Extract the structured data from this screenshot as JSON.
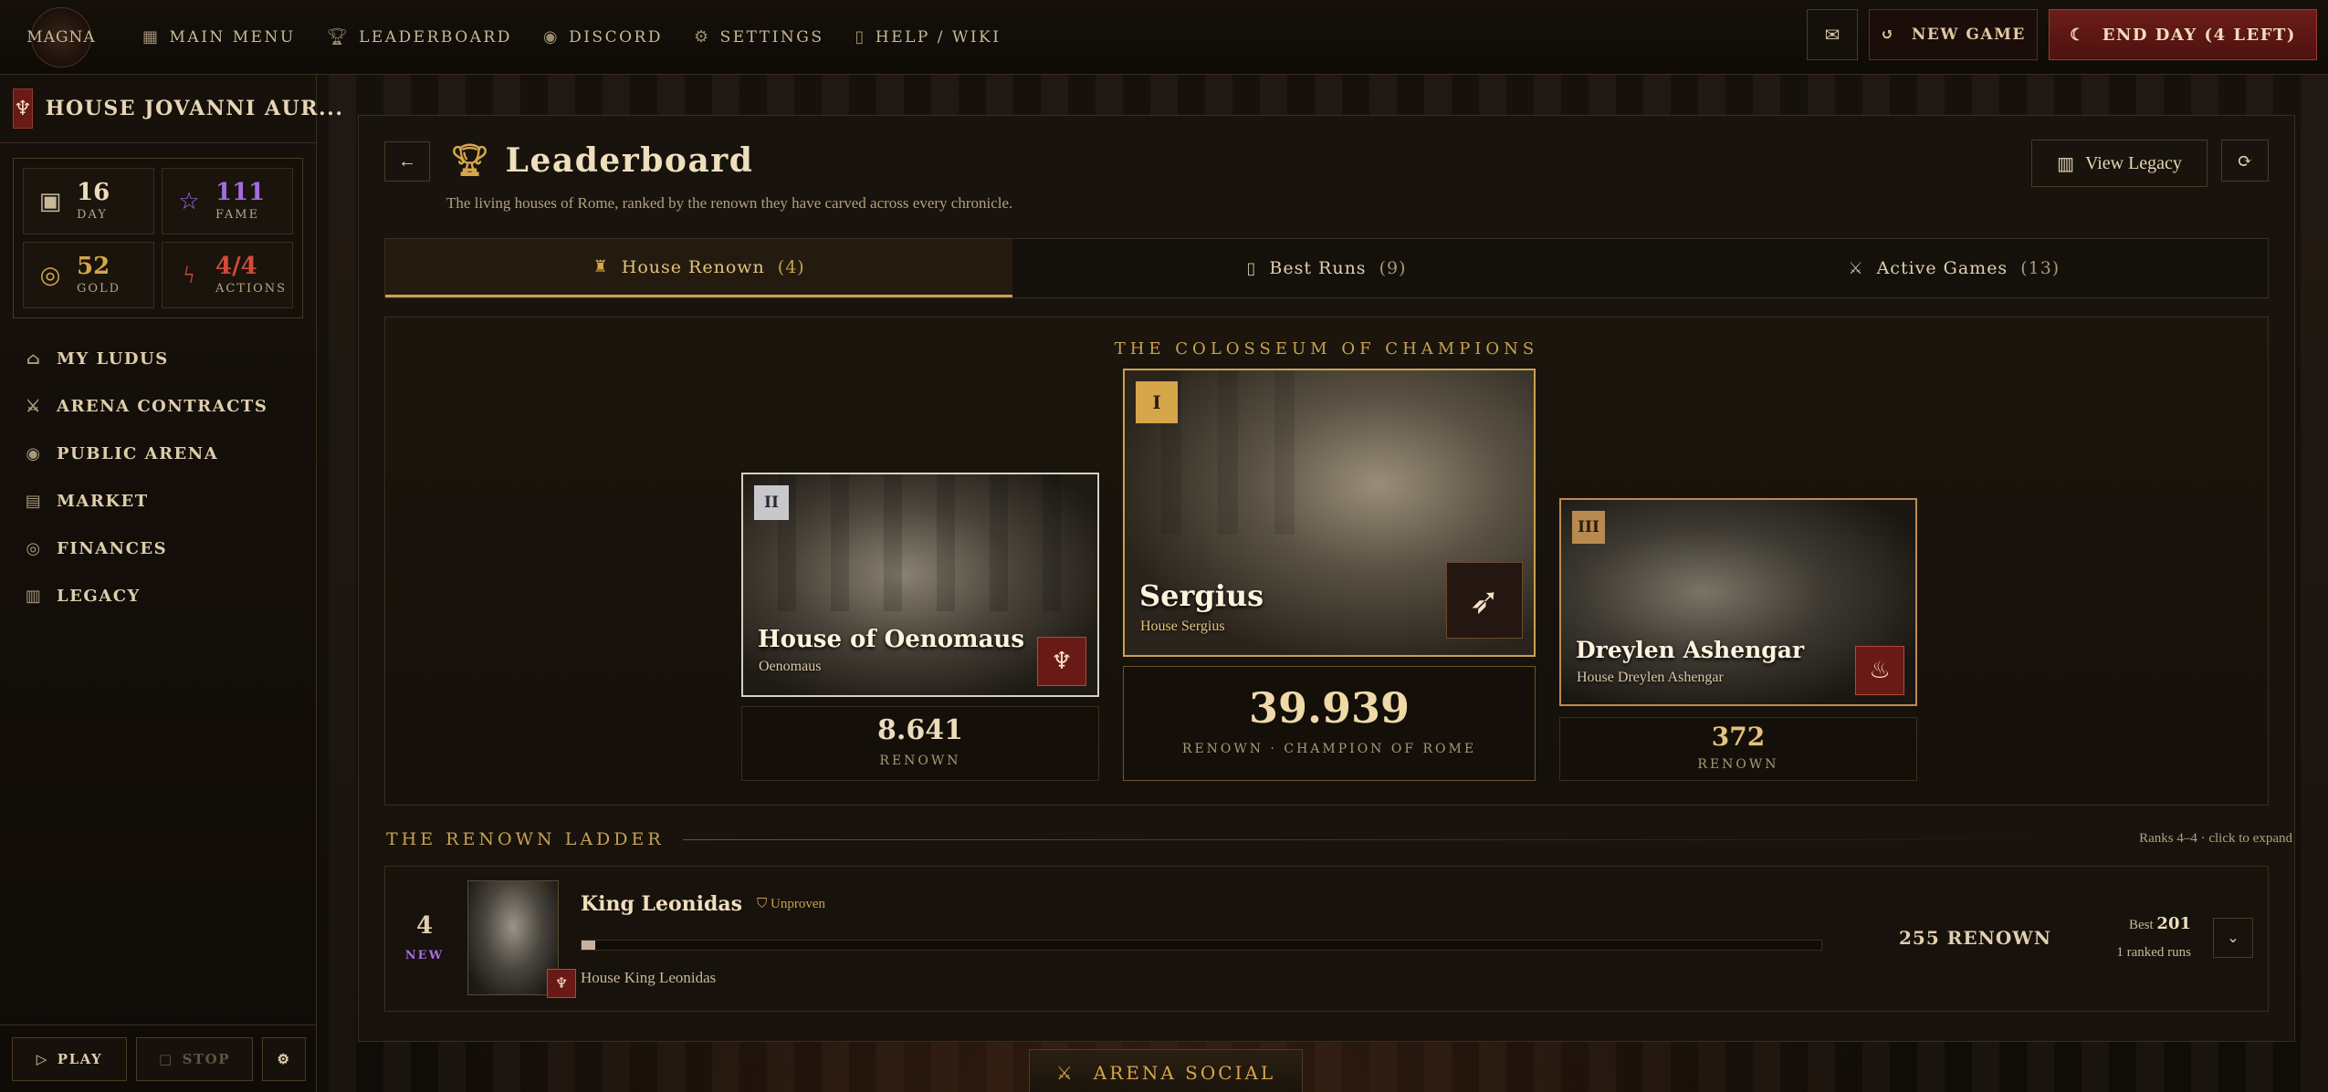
{
  "logo": "MAGNA",
  "nav": [
    {
      "label": "Main Menu",
      "icon": "grid-icon"
    },
    {
      "label": "Leaderboard",
      "icon": "trophy-icon"
    },
    {
      "label": "Discord",
      "icon": "discord-icon"
    },
    {
      "label": "Settings",
      "icon": "gear-icon"
    },
    {
      "label": "Help / Wiki",
      "icon": "book-icon"
    }
  ],
  "topbar": {
    "new_game": "NEW GAME",
    "end_day": "END DAY (4 LEFT)"
  },
  "sidebar": {
    "house_name": "HOUSE JOVANNI AUR...",
    "stats": {
      "day": {
        "value": "16",
        "label": "Day"
      },
      "fame": {
        "value": "111",
        "label": "Fame"
      },
      "gold": {
        "value": "52",
        "label": "Gold"
      },
      "actions": {
        "value": "4/4",
        "label": "Actions"
      }
    },
    "items": [
      {
        "label": "My Ludus",
        "icon": "home-icon"
      },
      {
        "label": "Arena Contracts",
        "icon": "swords-icon"
      },
      {
        "label": "Public Arena",
        "icon": "eye-icon"
      },
      {
        "label": "Market",
        "icon": "market-icon"
      },
      {
        "label": "Finances",
        "icon": "coins-icon"
      },
      {
        "label": "Legacy",
        "icon": "scroll-icon"
      }
    ],
    "play": "PLAY",
    "stop": "STOP"
  },
  "page": {
    "title": "Leaderboard",
    "subtitle": "The living houses of Rome, ranked by the renown they have carved across every chronicle.",
    "view_legacy": "View Legacy"
  },
  "tabs": [
    {
      "label": "House Renown",
      "count": "(4)",
      "active": true
    },
    {
      "label": "Best Runs",
      "count": "(9)",
      "active": false
    },
    {
      "label": "Active Games",
      "count": "(13)",
      "active": false
    }
  ],
  "podium": {
    "title": "The Colosseum of Champions",
    "first": {
      "rank": "I",
      "name": "Sergius",
      "house": "House Sergius",
      "score": "39.939",
      "label": "Renown · Champion of Rome"
    },
    "second": {
      "rank": "II",
      "name": "House of Oenomaus",
      "house": "Oenomaus",
      "score": "8.641",
      "label": "Renown"
    },
    "third": {
      "rank": "III",
      "name": "Dreylen Ashengar",
      "house": "House Dreylen Ashengar",
      "score": "372",
      "label": "Renown"
    }
  },
  "ladder": {
    "title": "The Renown Ladder",
    "hint": "Ranks 4–4 · click to expand",
    "rows": [
      {
        "rank": "4",
        "tag": "NEW",
        "name": "King Leonidas",
        "status": "Unproven",
        "house": "House King Leonidas",
        "score": "255 RENOWN",
        "progress": 0.011,
        "best_label": "Best",
        "best_value": "201",
        "runs": "1 ranked runs"
      }
    ]
  },
  "social": "Arena Social"
}
